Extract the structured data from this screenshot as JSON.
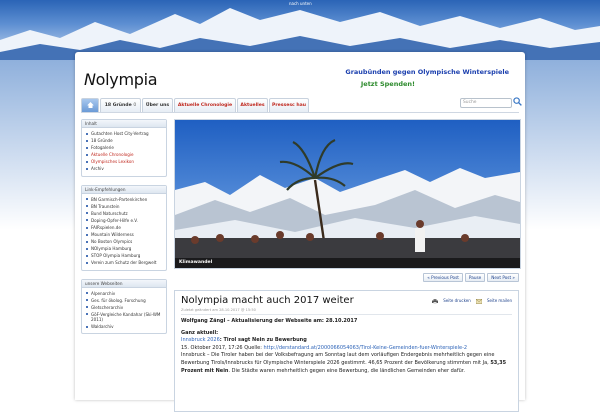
{
  "top_link": "nach unten",
  "header": {
    "logo_prefix": "N",
    "logo_rest": "olympia",
    "cta_primary": "Graubünden gegen Olympische Winterspiele",
    "cta_secondary": "Jetzt Spenden!"
  },
  "nav": {
    "tabs": [
      {
        "label": "18 Gründe",
        "badge": "0"
      },
      {
        "label": "Über uns"
      },
      {
        "label": "Aktuelle Chronologie"
      },
      {
        "label": "Aktuelles"
      },
      {
        "label": "Pressesc hau"
      }
    ],
    "search_placeholder": "Suche"
  },
  "sidebar": {
    "boxes": [
      {
        "title": "Inhalt",
        "items": [
          "Gutachten Host City-Vertrag",
          "18 Gründe",
          "Fotogalerie",
          "Aktuelle Chronologie",
          "Olympisches Lexikon",
          "Archiv"
        ]
      },
      {
        "title": "Link-Empfehlungen",
        "items": [
          "BN Garmisch-Partenkirchen",
          "BN Traunstein",
          "Bund Naturschutz",
          "Doping-Opfer-Hilfe e.V.",
          "FAIRspielen.de",
          "Mountain Wilderness",
          "No Boston Olympics",
          "NOlympia Hamburg",
          "STOP Olympia Hamburg",
          "Verein zum Schutz der Bergwelt"
        ]
      },
      {
        "title": "unsere Webseiten",
        "items": [
          "Alpenarchiv",
          "Ges. für ökolog. Forschung",
          "Gletscherarchiv",
          "GöF-Vergleiche Kandahar (Ski-WM 2011)",
          "Waldarchiv"
        ]
      }
    ]
  },
  "hero": {
    "caption": "Klimawandel",
    "pager": [
      "« Previous Post",
      "Pause",
      "Next Post »"
    ]
  },
  "post": {
    "title": "Nolympia macht auch 2017 weiter",
    "meta": "Zuletzt geändert am 28.10.2017 @ 15:50",
    "print_label": "Seite drucken",
    "mail_label": "Seite mailen",
    "heading": "Wolfgang Zängl – Aktualisierung der Webseite am: 28.10.2017",
    "ganz_aktuell": "Ganz aktuell:",
    "news_link": "Innsbruck 2026",
    "news_title": ": Tirol sagt Nein zu Bewerbung",
    "date_source": "15. Oktober 2017, 17:26 Quelle: ",
    "source_url": "http://derstandard.at/2000066054063/Tirol-Keine-Gemeinden-fuer-Winterspiele-2",
    "body1": "Innsbruck – Die Tiroler haben bei der Volksbefragung am Sonntag laut dem vorläufigen Endergebnis mehrheitlich gegen eine Bewerbung Tirols/Innsbrucks für Olympische Winterspiele 2026 gestimmt. 46,65 Prozent der Bevölkerung stimmten mit Ja, ",
    "body_bold": "53,35 Prozent mit Nein",
    "body2": ". Die Städte waren mehrheitlich gegen eine Bewerbung, die ländlichen Gemeinden eher dafür."
  },
  "colors": {
    "sky": "#2f6cc0",
    "red_link": "#c0281e",
    "green_cta": "#2c8a2c",
    "blue_cta": "#1b3fae"
  }
}
